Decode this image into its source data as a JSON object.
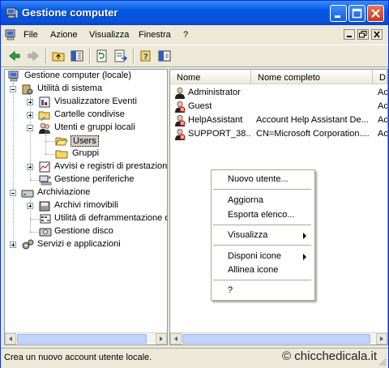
{
  "window": {
    "title": "Gestione computer"
  },
  "menubar": {
    "items": [
      "File",
      "Azione",
      "Visualizza",
      "Finestra",
      "?"
    ]
  },
  "toolbar": {
    "icons": [
      "back-icon",
      "forward-icon",
      "up-folder-icon",
      "show-hide-tree-icon",
      "refresh-icon",
      "export-list-icon",
      "help-icon",
      "properties-icon"
    ]
  },
  "tree": {
    "root": "Gestione computer (locale)",
    "nodes": [
      {
        "label": "Utilità di sistema"
      },
      {
        "label": "Visualizzatore Eventi"
      },
      {
        "label": "Cartelle condivise"
      },
      {
        "label": "Utenti e gruppi locali"
      },
      {
        "label": "Users"
      },
      {
        "label": "Gruppi"
      },
      {
        "label": "Avvisi e registri di prestazioni"
      },
      {
        "label": "Gestione periferiche"
      },
      {
        "label": "Archiviazione"
      },
      {
        "label": "Archivi rimovibili"
      },
      {
        "label": "Utilità di deframmentazione dischi"
      },
      {
        "label": "Gestione disco"
      },
      {
        "label": "Servizi e applicazioni"
      }
    ]
  },
  "list": {
    "columns": [
      "Nome",
      "Nome completo",
      "D"
    ],
    "rows": [
      {
        "name": "Administrator",
        "full": "",
        "desc": "Ac"
      },
      {
        "name": "Guest",
        "full": "",
        "desc": "Ac"
      },
      {
        "name": "HelpAssistant",
        "full": "Account Help Assistant De...",
        "desc": "Ac"
      },
      {
        "name": "SUPPORT_38...",
        "full": "CN=Microsoft Corporation....",
        "desc": "Ac"
      }
    ]
  },
  "context_menu": {
    "new_user": "Nuovo utente...",
    "refresh": "Aggiorna",
    "export": "Esporta elenco...",
    "view": "Visualizza",
    "arrange": "Disponi icone",
    "align": "Allinea icone",
    "help": "?"
  },
  "status": {
    "text": "Crea un nuovo account utente locale."
  },
  "watermark": {
    "text": "© chicchedicala.it"
  }
}
